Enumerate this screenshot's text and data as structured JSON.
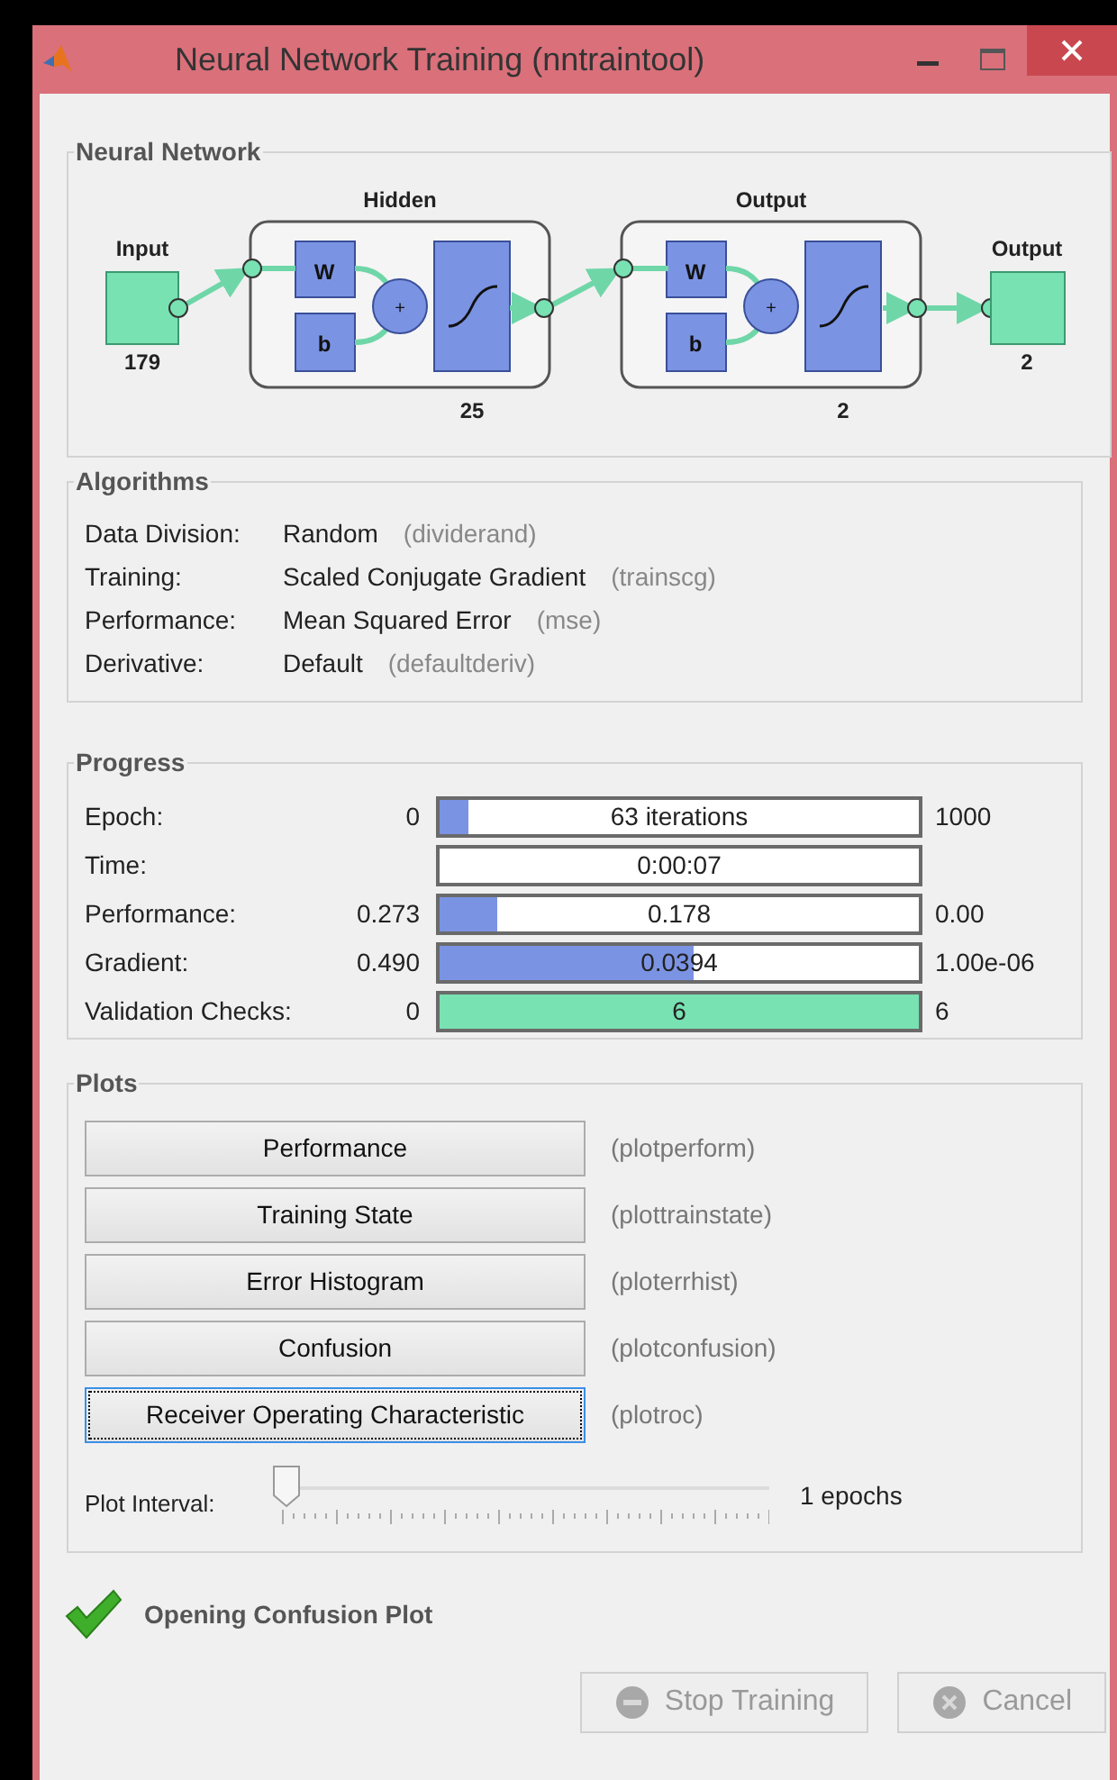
{
  "window": {
    "title": "Neural Network Training (nntraintool)"
  },
  "neural_network": {
    "title": "Neural Network",
    "input": {
      "label": "Input",
      "size": "179"
    },
    "layers": [
      {
        "name": "Hidden",
        "size": "25",
        "weight": "W",
        "bias": "b",
        "sum": "+"
      },
      {
        "name": "Output",
        "size": "2",
        "weight": "W",
        "bias": "b",
        "sum": "+"
      }
    ],
    "output": {
      "label": "Output",
      "size": "2"
    }
  },
  "algorithms": {
    "title": "Algorithms",
    "rows": [
      {
        "label": "Data Division:",
        "value": "Random",
        "function": "(dividerand)"
      },
      {
        "label": "Training:",
        "value": "Scaled Conjugate Gradient",
        "function": "(trainscg)"
      },
      {
        "label": "Performance:",
        "value": "Mean Squared Error",
        "function": "(mse)"
      },
      {
        "label": "Derivative:",
        "value": "Default",
        "function": "(defaultderiv)"
      }
    ]
  },
  "progress": {
    "title": "Progress",
    "rows": [
      {
        "label": "Epoch:",
        "start": "0",
        "bar_text": "63 iterations",
        "end": "1000",
        "level": 0.06,
        "color": "#7b93e3"
      },
      {
        "label": "Time:",
        "bar_text": "0:00:07"
      },
      {
        "label": "Performance:",
        "start": "0.273",
        "bar_text": "0.178",
        "end": "0.00",
        "level": 0.12,
        "color": "#7b93e3"
      },
      {
        "label": "Gradient:",
        "start": "0.490",
        "bar_text": "0.0394",
        "end": "1.00e-06",
        "level": 0.53,
        "color": "#7b93e3"
      },
      {
        "label": "Validation Checks:",
        "start": "0",
        "bar_text": "6",
        "end": "6",
        "level": 1,
        "color": "#78e2b2"
      }
    ]
  },
  "plots": {
    "title": "Plots",
    "buttons": [
      {
        "label": "Performance",
        "function": "(plotperform)",
        "focused": false
      },
      {
        "label": "Training State",
        "function": "(plottrainstate)",
        "focused": false
      },
      {
        "label": "Error Histogram",
        "function": "(ploterrhist)",
        "focused": false
      },
      {
        "label": "Confusion",
        "function": "(plotconfusion)",
        "focused": false
      },
      {
        "label": "Receiver Operating Characteristic",
        "function": "(plotroc)",
        "focused": true
      }
    ],
    "interval": {
      "label": "Plot Interval:",
      "level": 0,
      "reading": "1 epochs"
    }
  },
  "status": {
    "text": "Opening Confusion Plot"
  },
  "buttons": [
    {
      "label": "Stop Training",
      "kind": "stop",
      "disabled": true
    },
    {
      "label": "Cancel",
      "kind": "cancel",
      "disabled": true
    }
  ]
}
